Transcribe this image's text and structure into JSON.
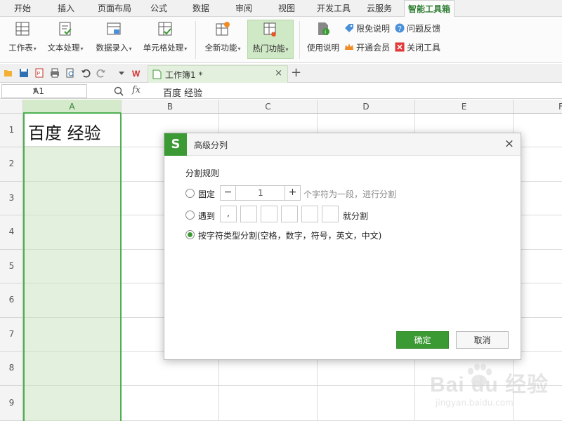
{
  "ribbon_tabs": [
    "开始",
    "插入",
    "页面布局",
    "公式",
    "数据",
    "审阅",
    "视图",
    "开发工具",
    "云服务",
    "智能工具箱"
  ],
  "active_tab": "智能工具箱",
  "ribbon": {
    "worksheet": "工作表",
    "text_process": "文本处理",
    "data_entry": "数据录入",
    "cell_process": "单元格处理",
    "all_functions": "全新功能",
    "hot_functions": "热门功能",
    "usage_guide": "使用说明",
    "disclaimer": "限免说明",
    "feedback": "问题反馈",
    "open_member": "开通会员",
    "close_tool": "关闭工具"
  },
  "doc_tab": {
    "title": "工作簿1 *",
    "close": "×",
    "new": "+"
  },
  "formula_bar": {
    "cell_ref": "A1",
    "fx": "fx",
    "content": "百度  经验"
  },
  "columns": [
    "A",
    "B",
    "C",
    "D",
    "E",
    "F"
  ],
  "rows": [
    "1",
    "2",
    "3",
    "4",
    "5",
    "6",
    "7",
    "8",
    "9"
  ],
  "cell_a1": "百度  经验",
  "dialog": {
    "logo": "S",
    "title": "高级分列",
    "section": "分割规则",
    "fixed_label": "固定",
    "fixed_value": "1",
    "fixed_hint": "个字符为一段，进行分割",
    "meet_label": "遇到",
    "meet_chars": [
      ",",
      "",
      "",
      "",
      "",
      ""
    ],
    "meet_suffix": "就分割",
    "by_type_label": "按字符类型分割(空格，数字，符号，英文，中文)",
    "selected_option": "by_type",
    "ok": "确定",
    "cancel": "取消",
    "close": "×"
  },
  "watermark": {
    "logo": "Bai du 经验",
    "url": "jingyan.baidu.com"
  },
  "colors": {
    "accent": "#3c9a34",
    "column_highlight": "#e3f0de",
    "hot_button": "#cfe8c5"
  }
}
